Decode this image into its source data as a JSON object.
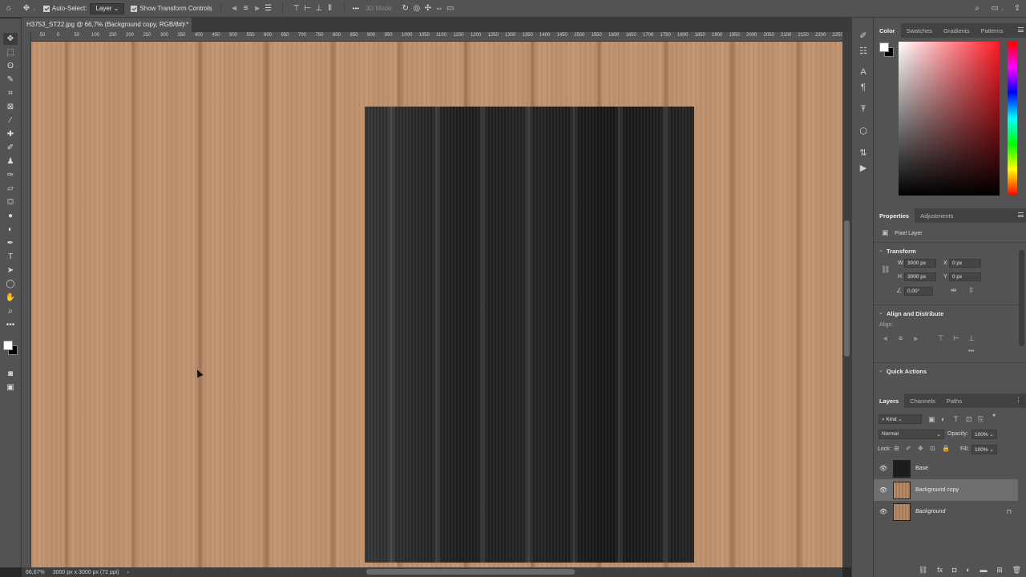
{
  "options_bar": {
    "move_icon": "move-icon",
    "auto_select_label": "Auto-Select:",
    "auto_select_value": "Layer",
    "show_transform_label": "Show Transform Controls",
    "threed_mode_label": "3D Mode:",
    "more_label": "•••"
  },
  "document": {
    "tab_title": "H3753_ST22.jpg @ 66,7% (Background copy, RGB/8#) *",
    "tab_close": "×",
    "zoom": "66,67%",
    "doc_size": "3000 px x 3000 px (72 ppi)"
  },
  "ruler": {
    "h_ticks": [
      "100",
      "50",
      "0",
      "50",
      "100",
      "150",
      "200",
      "250",
      "300",
      "350",
      "400",
      "450",
      "500",
      "550",
      "600",
      "650",
      "700",
      "750",
      "800",
      "850",
      "900",
      "950",
      "1000",
      "1050",
      "1100",
      "1150",
      "1200",
      "1250",
      "1300",
      "1350",
      "1400",
      "1450",
      "1500",
      "1550",
      "1600",
      "1650",
      "1700",
      "1750",
      "1800",
      "1850",
      "1900",
      "1950",
      "2000",
      "2050",
      "2100",
      "2150",
      "2200",
      "2250",
      "2300",
      "2350"
    ]
  },
  "color_panel": {
    "tabs": [
      "Color",
      "Swatches",
      "Gradients",
      "Patterns"
    ],
    "active_tab": "Color",
    "foreground": "#ffffff",
    "background": "#000000",
    "hue_color": "#ff1b25"
  },
  "properties_panel": {
    "tabs": [
      "Properties",
      "Adjustments"
    ],
    "layer_type": "Pixel Layer",
    "transform_header": "Transform",
    "w_label": "W",
    "w_value": "3000 px",
    "h_label": "H",
    "h_value": "3000 px",
    "x_label": "X",
    "x_value": "0 px",
    "y_label": "Y",
    "y_value": "0 px",
    "angle_value": "0,00°",
    "align_header": "Align and Distribute",
    "align_label": "Align:",
    "quick_actions_header": "Quick Actions"
  },
  "layers_panel": {
    "tabs": [
      "Layers",
      "Channels",
      "Paths"
    ],
    "filter_label": "Kind",
    "blend_mode": "Normal",
    "opacity_label": "Opacity:",
    "opacity_value": "100%",
    "lock_label": "Lock:",
    "fill_label": "Fill:",
    "fill_value": "100%",
    "layers": [
      {
        "name": "Base",
        "thumb": "dark"
      },
      {
        "name": "Background copy",
        "thumb": "wood",
        "selected": true
      },
      {
        "name": "Background",
        "thumb": "wood",
        "locked": true
      }
    ]
  }
}
